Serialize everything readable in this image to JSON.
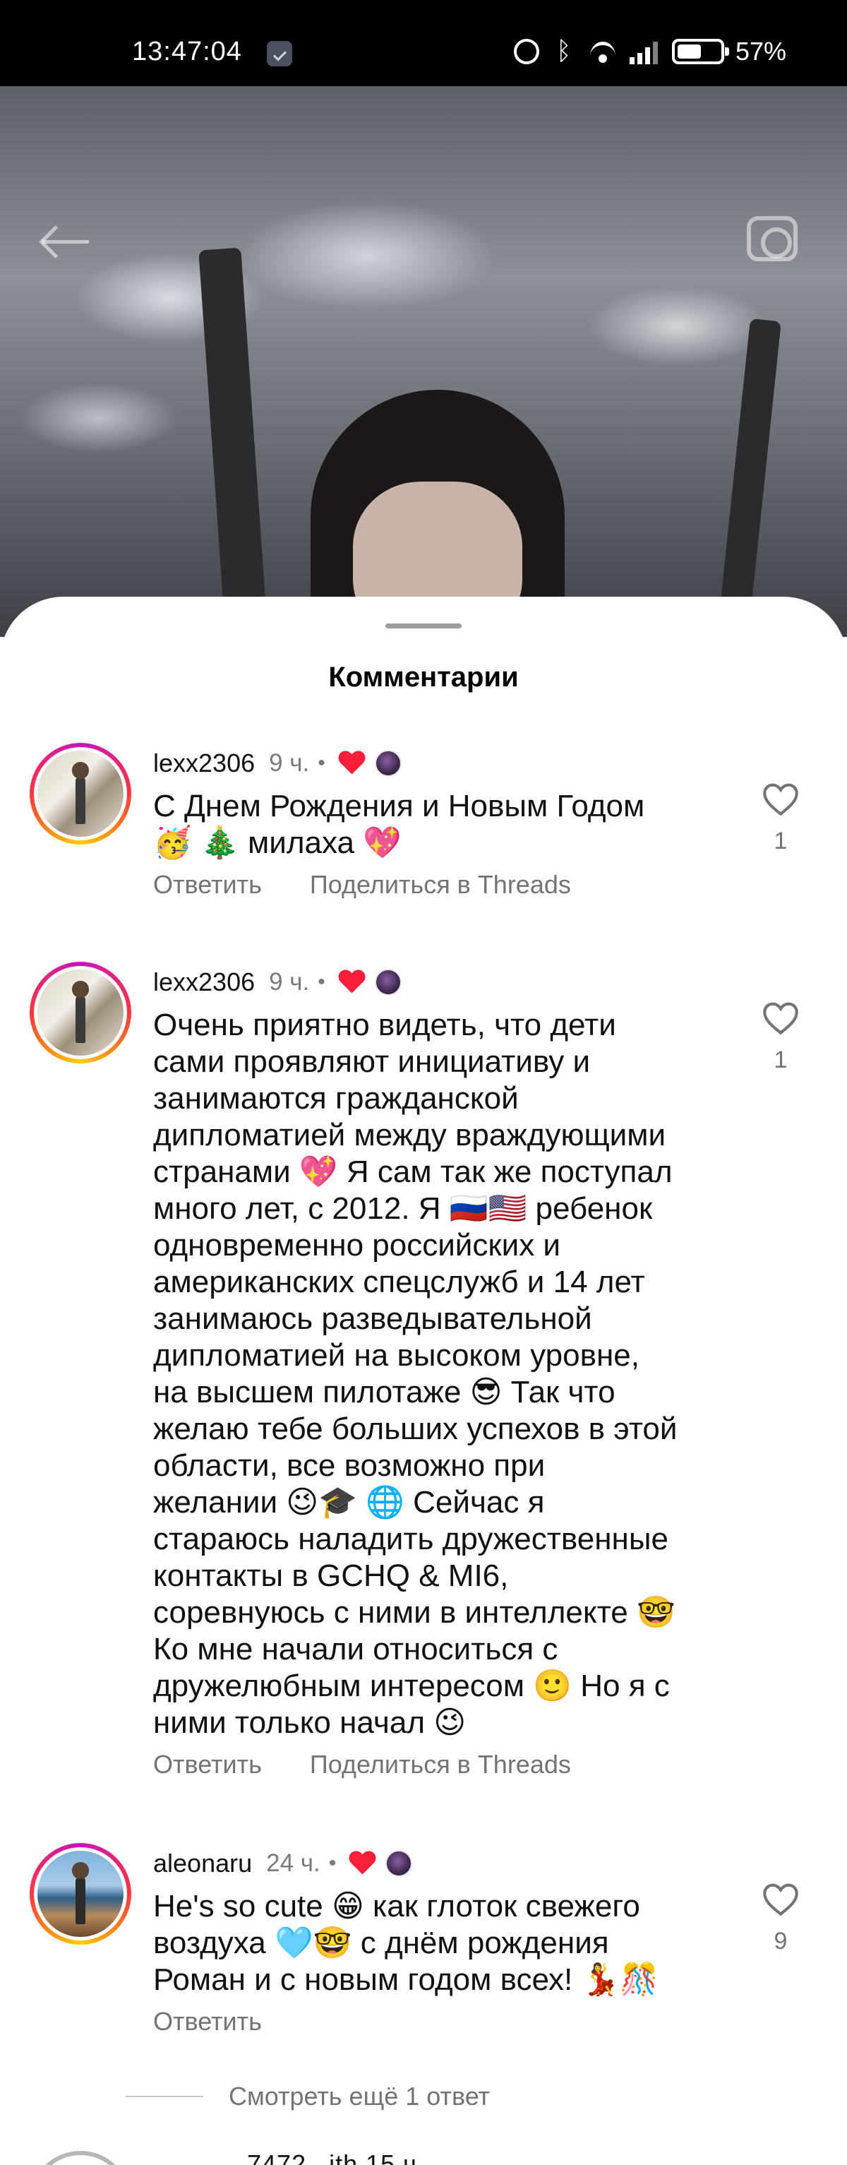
{
  "status_bar": {
    "time": "13:47:04",
    "battery_percent": "57%",
    "battery_level": 0.57,
    "icons": [
      "app-notification-icon",
      "alarm-icon",
      "bluetooth-icon",
      "wifi-icon",
      "signal-icon",
      "battery-icon"
    ]
  },
  "header": {
    "back_icon": "back-arrow-icon",
    "camera_icon": "camera-icon"
  },
  "sheet": {
    "title": "Комментарии"
  },
  "comments": [
    {
      "username": "lexx2306",
      "time": "9 ч.",
      "dot": "•",
      "text": "С Днем Рождения и Новым Годом\n🥳 🎄 милаха 💖",
      "reply_label": "Ответить",
      "share_label": "Поделиться в Threads",
      "likes": "1"
    },
    {
      "username": "lexx2306",
      "time": "9 ч.",
      "dot": "•",
      "text": "Очень приятно видеть, что дети\nсами проявляют инициативу и\nзанимаются гражданской\nдипломатией между враждующими\nстранами 💖 Я сам так же поступал\nмного лет, с 2012. Я 🇷🇺🇺🇸 ребенок\nодновременно российских и\nамериканских спецслужб и 14 лет\nзанимаюсь разведывательной\nдипломатией на высоком уровне,\nна высшем пилотаже 😎 Так что\nжелаю тебе больших успехов в этой\nобласти, все возможно при\nжелании 😉🎓 🌐 Сейчас я\nстараюсь наладить дружественные\nконтакты в GCHQ & MI6,\nсоревнуюсь с ними в интеллекте 🤓\nКо мне начали относиться с\nдружелюбным интересом 🙂 Но я с\nними только начал 😉",
      "reply_label": "Ответить",
      "share_label": "Поделиться в Threads",
      "likes": "1"
    },
    {
      "username": "aleonaru",
      "time": "24 ч.",
      "dot": "•",
      "text": "He's so cute 😁 как глоток свежего\nвоздуха 🩵🤓 с днём рождения\nРоман и с новым годом всех! 💃🎊",
      "reply_label": "Ответить",
      "likes": "9"
    }
  ],
  "more_replies": "Смотреть ещё 1 ответ",
  "peek_comment": {
    "username_partial": "7472 _ith  15 ч."
  }
}
